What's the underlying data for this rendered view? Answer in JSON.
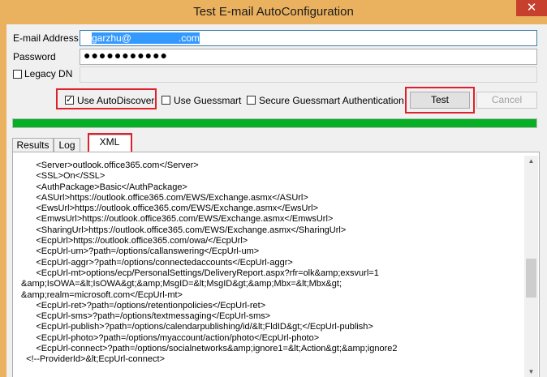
{
  "window": {
    "title": "Test E-mail AutoConfiguration",
    "close_glyph": "✕"
  },
  "form": {
    "email_label": "E-mail Address",
    "email_value_prefix": "garzhu@",
    "email_value_suffix": ".com",
    "password_label": "Password",
    "password_value": "●●●●●●●●●●●",
    "legacy_dn_label": "Legacy DN",
    "legacy_dn_checked": false
  },
  "options": {
    "autodiscover_label": "Use AutoDiscover",
    "autodiscover_checked": true,
    "guessmart_label": "Use Guessmart",
    "guessmart_checked": false,
    "secure_guessmart_label": "Secure Guessmart Authentication",
    "secure_guessmart_checked": false,
    "check_glyph": "✓"
  },
  "buttons": {
    "test_label": "Test",
    "cancel_label": "Cancel"
  },
  "progress": {
    "value": 1.0,
    "color": "#06b025"
  },
  "tabs": [
    {
      "label": "Results",
      "active": false
    },
    {
      "label": "Log",
      "active": false
    },
    {
      "label": "XML",
      "active": true
    }
  ],
  "xml_lines": [
    "      <Server>outlook.office365.com</Server>",
    "      <SSL>On</SSL>",
    "      <AuthPackage>Basic</AuthPackage>",
    "      <ASUrl>https://outlook.office365.com/EWS/Exchange.asmx</ASUrl>",
    "      <EwsUrl>https://outlook.office365.com/EWS/Exchange.asmx</EwsUrl>",
    "      <EmwsUrl>https://outlook.office365.com/EWS/Exchange.asmx</EmwsUrl>",
    "      <SharingUrl>https://outlook.office365.com/EWS/Exchange.asmx</SharingUrl>",
    "      <EcpUrl>https://outlook.office365.com/owa/</EcpUrl>",
    "      <EcpUrl-um>?path=/options/callanswering</EcpUrl-um>",
    "      <EcpUrl-aggr>?path=/options/connectedaccounts</EcpUrl-aggr>",
    "      <EcpUrl-mt>options/ecp/PersonalSettings/DeliveryReport.aspx?rfr=olk&amp;exsvurl=1",
    "&amp;IsOWA=&lt;IsOWA&gt;&amp;MsgID=&lt;MsgID&gt;&amp;Mbx=&lt;Mbx&gt;",
    "&amp;realm=microsoft.com</EcpUrl-mt>",
    "      <EcpUrl-ret>?path=/options/retentionpolicies</EcpUrl-ret>",
    "      <EcpUrl-sms>?path=/options/textmessaging</EcpUrl-sms>",
    "      <EcpUrl-publish>?path=/options/calendarpublishing/id/&lt;FldID&gt;</EcpUrl-publish>",
    "      <EcpUrl-photo>?path=/options/myaccount/action/photo</EcpUrl-photo>",
    "      <EcpUrl-connect>?path=/options/socialnetworks&amp;ignore1=&lt;Action&gt;&amp;ignore2",
    "  <!--ProviderId>&lt;EcpUrl-connect>"
  ],
  "scrollbar": {
    "up_glyph": "▲",
    "down_glyph": "▼"
  },
  "colors": {
    "highlight_box": "#e0202a",
    "title_bar": "#eab15f",
    "selection": "#3399ff"
  }
}
